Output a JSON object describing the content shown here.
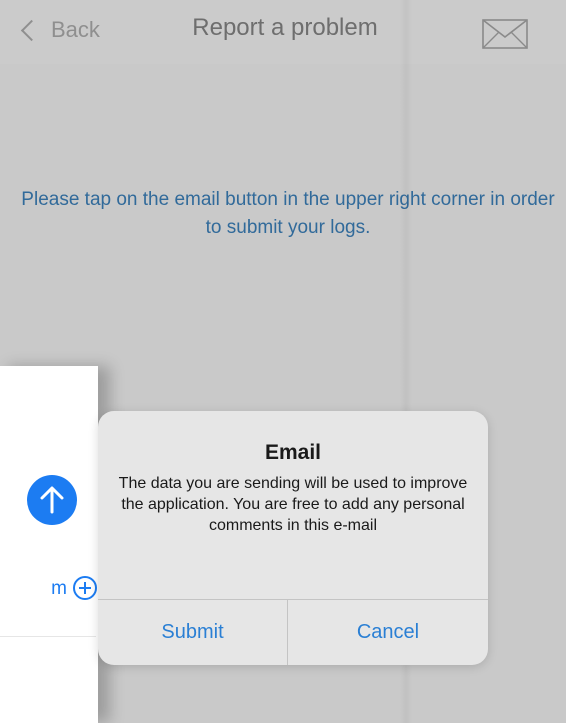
{
  "nav": {
    "back_label": "Back",
    "title": "Report a problem",
    "mail_icon": "envelope-icon"
  },
  "content": {
    "instructions": "Please tap on the email button in the upper right corner in order to submit your logs."
  },
  "front_card": {
    "send_icon": "arrow-up-icon",
    "add_label_fragment": "m",
    "add_icon": "plus-circle-icon"
  },
  "alert": {
    "title": "Email",
    "message": "The data you are sending will be used to improve the application. You are free to add any personal comments in this e-mail",
    "submit_label": "Submit",
    "cancel_label": "Cancel"
  },
  "colors": {
    "background": "#c9c9c9",
    "link_blue": "#2a7fd4",
    "instruction_blue": "#316a9a",
    "accent_blue": "#1c7cf2"
  }
}
